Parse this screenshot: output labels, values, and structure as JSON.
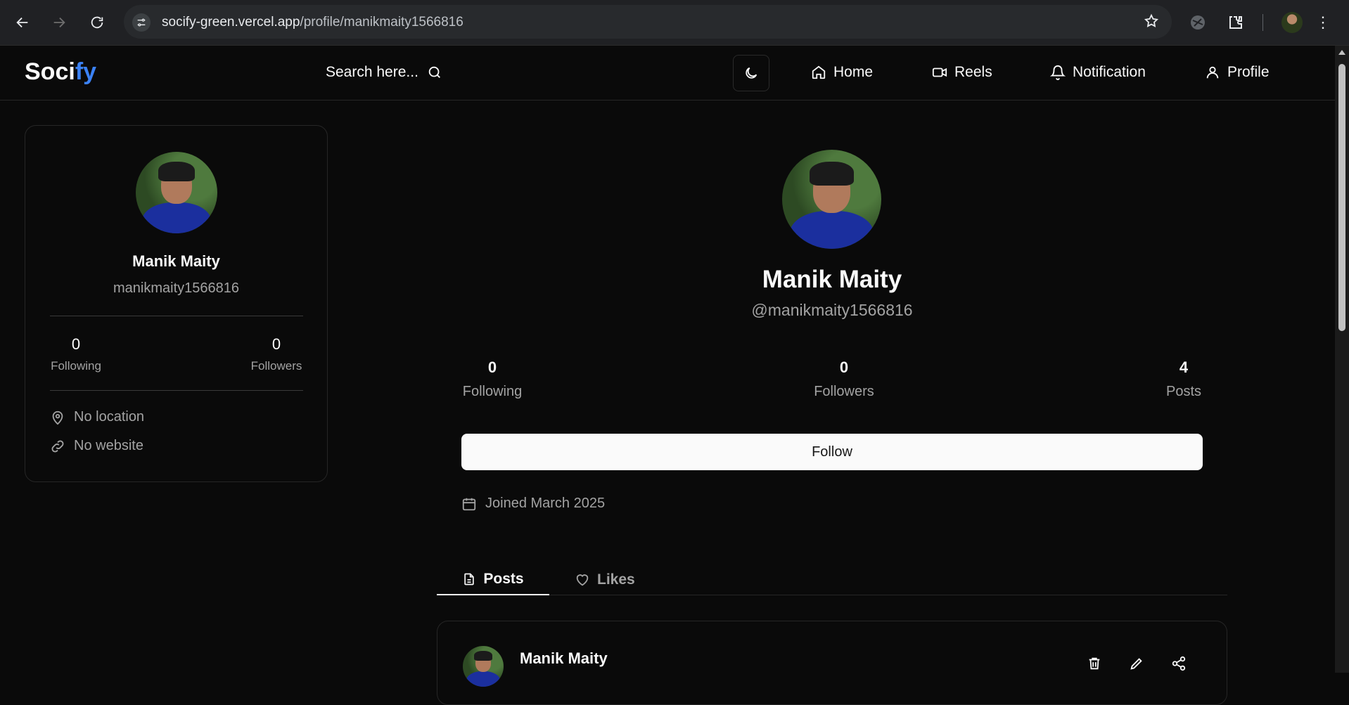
{
  "browser": {
    "url_domain": "socify-green.vercel.app",
    "url_path": "/profile/manikmaity1566816"
  },
  "header": {
    "logo_main": "Soci",
    "logo_accent": "fy",
    "search_placeholder": "Search here...",
    "nav": {
      "home": "Home",
      "reels": "Reels",
      "notification": "Notification",
      "profile": "Profile"
    }
  },
  "sidebar": {
    "name": "Manik Maity",
    "username": "manikmaity1566816",
    "following_count": "0",
    "following_label": "Following",
    "followers_count": "0",
    "followers_label": "Followers",
    "location": "No location",
    "website": "No website"
  },
  "profile": {
    "name": "Manik Maity",
    "handle": "@manikmaity1566816",
    "following_count": "0",
    "following_label": "Following",
    "followers_count": "0",
    "followers_label": "Followers",
    "posts_count": "4",
    "posts_label": "Posts",
    "follow_label": "Follow",
    "joined": "Joined March 2025"
  },
  "tabs": {
    "posts": "Posts",
    "likes": "Likes"
  },
  "post": {
    "author": "Manik Maity"
  }
}
